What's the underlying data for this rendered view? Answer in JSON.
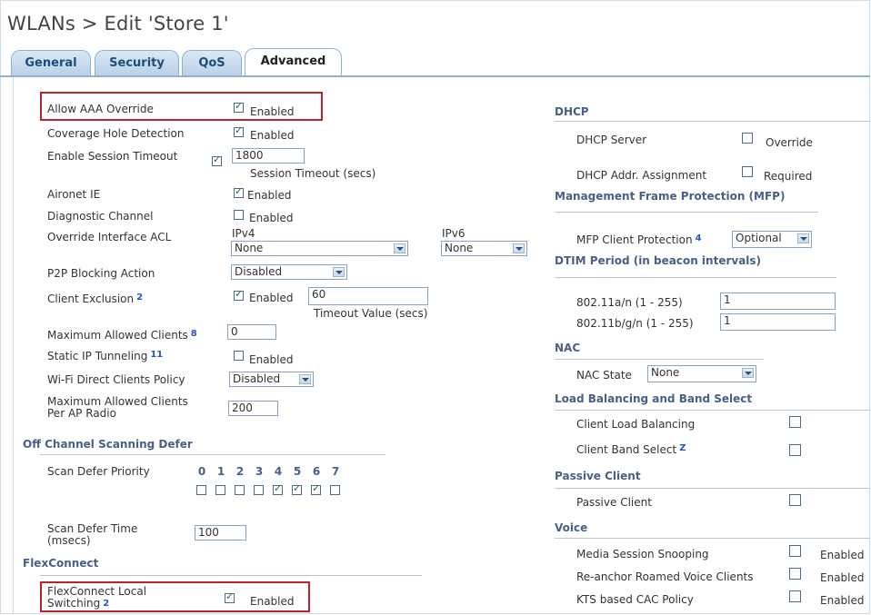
{
  "title": "WLANs > Edit  'Store 1'",
  "tabs": [
    {
      "label": "General"
    },
    {
      "label": "Security"
    },
    {
      "label": "QoS"
    },
    {
      "label": "Advanced"
    }
  ],
  "left": {
    "allow_aaa": {
      "label": "Allow AAA Override",
      "checked": true,
      "value": "Enabled"
    },
    "coverage_hole": {
      "label": "Coverage Hole Detection",
      "checked": true,
      "value": "Enabled"
    },
    "session_timeout": {
      "label": "Enable Session Timeout",
      "checked": true,
      "value": "1800",
      "hint": "Session Timeout (secs)"
    },
    "aironet": {
      "label": "Aironet IE",
      "checked": true,
      "value": "Enabled"
    },
    "diagnostic": {
      "label": "Diagnostic Channel",
      "checked": false,
      "value": "Enabled"
    },
    "override_acl": {
      "label": "Override Interface ACL",
      "ipv4_label": "IPv4",
      "ipv4_value": "None",
      "ipv6_label": "IPv6",
      "ipv6_value": "None"
    },
    "p2p": {
      "label": "P2P Blocking Action",
      "value": "Disabled"
    },
    "client_exclusion": {
      "label": "Client Exclusion",
      "footnote": "2",
      "checked": true,
      "value": "Enabled",
      "timeout": "60",
      "hint": "Timeout Value (secs)"
    },
    "max_clients": {
      "label": "Maximum Allowed Clients",
      "footnote": "8",
      "value": "0"
    },
    "static_ip": {
      "label": "Static IP Tunneling",
      "footnote": "11",
      "checked": false,
      "value": "Enabled"
    },
    "wifi_direct": {
      "label": "Wi-Fi Direct Clients Policy",
      "value": "Disabled"
    },
    "max_clients_ap": {
      "label_line1": "Maximum Allowed Clients",
      "label_line2": "Per AP Radio",
      "value": "200"
    },
    "off_channel": {
      "heading": "Off Channel Scanning Defer",
      "priority_label": "Scan Defer Priority",
      "priorities": [
        {
          "num": "0",
          "checked": false
        },
        {
          "num": "1",
          "checked": false
        },
        {
          "num": "2",
          "checked": false
        },
        {
          "num": "3",
          "checked": false
        },
        {
          "num": "4",
          "checked": true
        },
        {
          "num": "5",
          "checked": true
        },
        {
          "num": "6",
          "checked": true
        },
        {
          "num": "7",
          "checked": false
        }
      ],
      "defer_time_line1": "Scan Defer Time",
      "defer_time_line2": "(msecs)",
      "defer_time_value": "100"
    },
    "flexconnect": {
      "heading": "FlexConnect",
      "label_line1": "FlexConnect Local",
      "label_line2": "Switching",
      "footnote": "2",
      "checked": true,
      "value": "Enabled"
    }
  },
  "right": {
    "dhcp": {
      "heading": "DHCP",
      "server_label": "DHCP Server",
      "server_checked": false,
      "server_value": "Override",
      "addr_label": "DHCP Addr. Assignment",
      "addr_checked": false,
      "addr_value": "Required"
    },
    "mfp": {
      "heading": "Management Frame Protection (MFP)",
      "label": "MFP Client Protection",
      "footnote": "4",
      "value": "Optional"
    },
    "dtim": {
      "heading": "DTIM Period (in beacon intervals)",
      "a_label": "802.11a/n (1 - 255)",
      "a_value": "1",
      "b_label": "802.11b/g/n (1 - 255)",
      "b_value": "1"
    },
    "nac": {
      "heading": "NAC",
      "label": "NAC State",
      "value": "None"
    },
    "load_balancing": {
      "heading": "Load Balancing and Band Select",
      "clb_label": "Client Load Balancing",
      "clb_checked": false,
      "cbs_label": "Client Band Select",
      "cbs_footnote": "Z",
      "cbs_checked": false
    },
    "passive": {
      "heading": "Passive Client",
      "label": "Passive Client",
      "checked": false
    },
    "voice": {
      "heading": "Voice",
      "items": [
        {
          "label": "Media Session Snooping",
          "checked": false,
          "value": "Enabled"
        },
        {
          "label": "Re-anchor Roamed Voice Clients",
          "checked": false,
          "value": "Enabled"
        },
        {
          "label": "KTS based CAC Policy",
          "checked": false,
          "value": "Enabled"
        }
      ]
    }
  },
  "colors": {
    "highlight": "#c0202a",
    "section": "#4a5f86",
    "tab_border": "#8fb2d3"
  }
}
